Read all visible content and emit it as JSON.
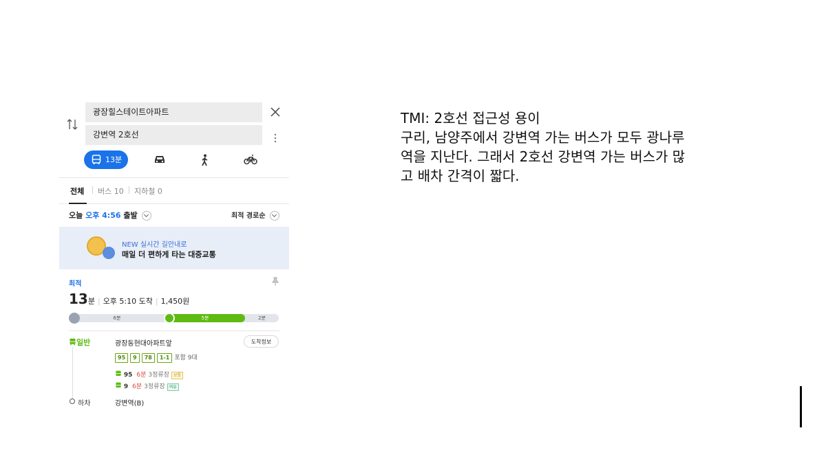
{
  "search": {
    "from": "광장힐스테이트아파트",
    "to": "강변역 2호선"
  },
  "modes": {
    "bus_time": "13분"
  },
  "tabs": {
    "all": "전체",
    "bus": "버스 10",
    "subway": "지하철 0"
  },
  "depart": {
    "prefix": "오늘 ",
    "time": "오후 4:56",
    "suffix": " 출발"
  },
  "sort": {
    "label": "최적 경로순"
  },
  "banner": {
    "line1": "NEW 실시간 길안내로",
    "line2": "매일 더 편하게 타는 대중교통"
  },
  "route": {
    "badge": "최적",
    "minutes": "13",
    "minutes_unit": "분",
    "arrival": "오후 5:10 도착",
    "fare": "1,450원",
    "bar": {
      "walk": "6분",
      "bus": "5분",
      "walk2": "2분",
      "walk_fraction": 0.46,
      "bus_fraction": 0.38
    },
    "segment_label": "일반",
    "boarding_stop": "광장동현대아파트앞",
    "arrival_info_button": "도착정보",
    "route_numbers": [
      "95",
      "9",
      "78",
      "1-1"
    ],
    "route_more": "포함 9대",
    "arrivals": [
      {
        "number": "95",
        "mins": "6분",
        "stops": "3정류장",
        "status": "보통"
      },
      {
        "number": "9",
        "mins": "6분",
        "stops": "3정류장",
        "status": "여유"
      }
    ],
    "alight_label": "하차",
    "alight_stop": "강변역(B)"
  },
  "note": {
    "lines": [
      "TMI: 2호선 접근성 용이",
      "구리, 남양주에서 강변역 가는 버스가 모두 광나루",
      "역을 지난다. 그래서 2호선 강변역 가는 버스가 많",
      "고 배차 간격이 짧다."
    ]
  },
  "colors": {
    "accent": "#1a73e8",
    "bus_green": "#5dbb12",
    "minutes_red": "#d94a3a"
  }
}
